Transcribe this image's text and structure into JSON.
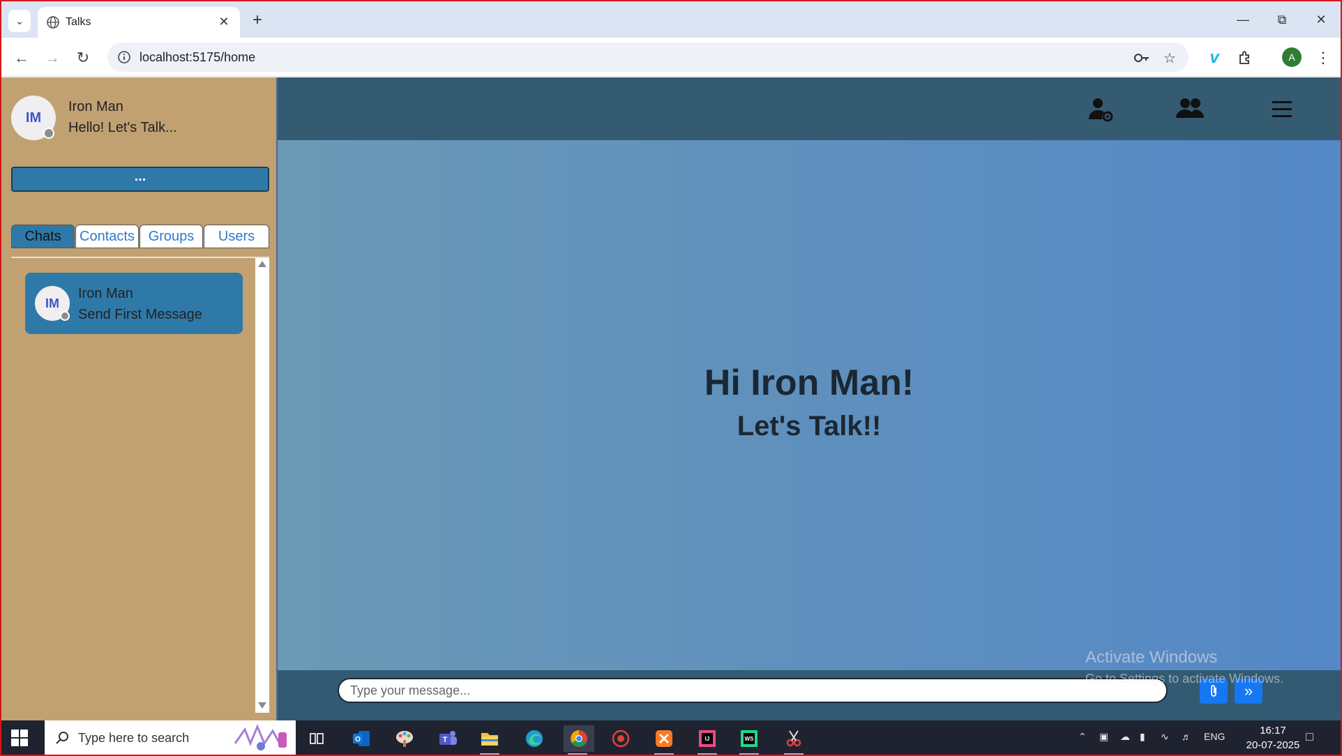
{
  "browser": {
    "tab_title": "Talks",
    "url": "localhost:5175/home",
    "profile_initial": "A"
  },
  "app": {
    "user": {
      "initials": "IM",
      "name": "Iron Man",
      "status": "Hello! Let's Talk..."
    },
    "more_button": "...",
    "tabs": [
      "Chats",
      "Contacts",
      "Groups",
      "Users"
    ],
    "active_tab": "Chats",
    "chats": [
      {
        "initials": "IM",
        "name": "Iron Man",
        "preview": "Send First Message"
      }
    ],
    "welcome_title": "Hi Iron Man!",
    "welcome_subtitle": "Let's Talk!!",
    "message_placeholder": "Type your message..."
  },
  "watermark": {
    "line1": "Activate Windows",
    "line2": "Go to Settings to activate Windows."
  },
  "taskbar": {
    "search_placeholder": "Type here to search",
    "language": "ENG",
    "time": "16:17",
    "date": "20-07-2025",
    "apps": [
      "task-view",
      "outlook",
      "paint",
      "teams",
      "file-explorer",
      "edge",
      "chrome",
      "recorder",
      "xampp",
      "intellij",
      "webstorm",
      "git-tool"
    ]
  },
  "colors": {
    "sidebar": "#c1a172",
    "header": "#355b73",
    "accent": "#2f79a8",
    "button_blue": "#1677f2"
  }
}
